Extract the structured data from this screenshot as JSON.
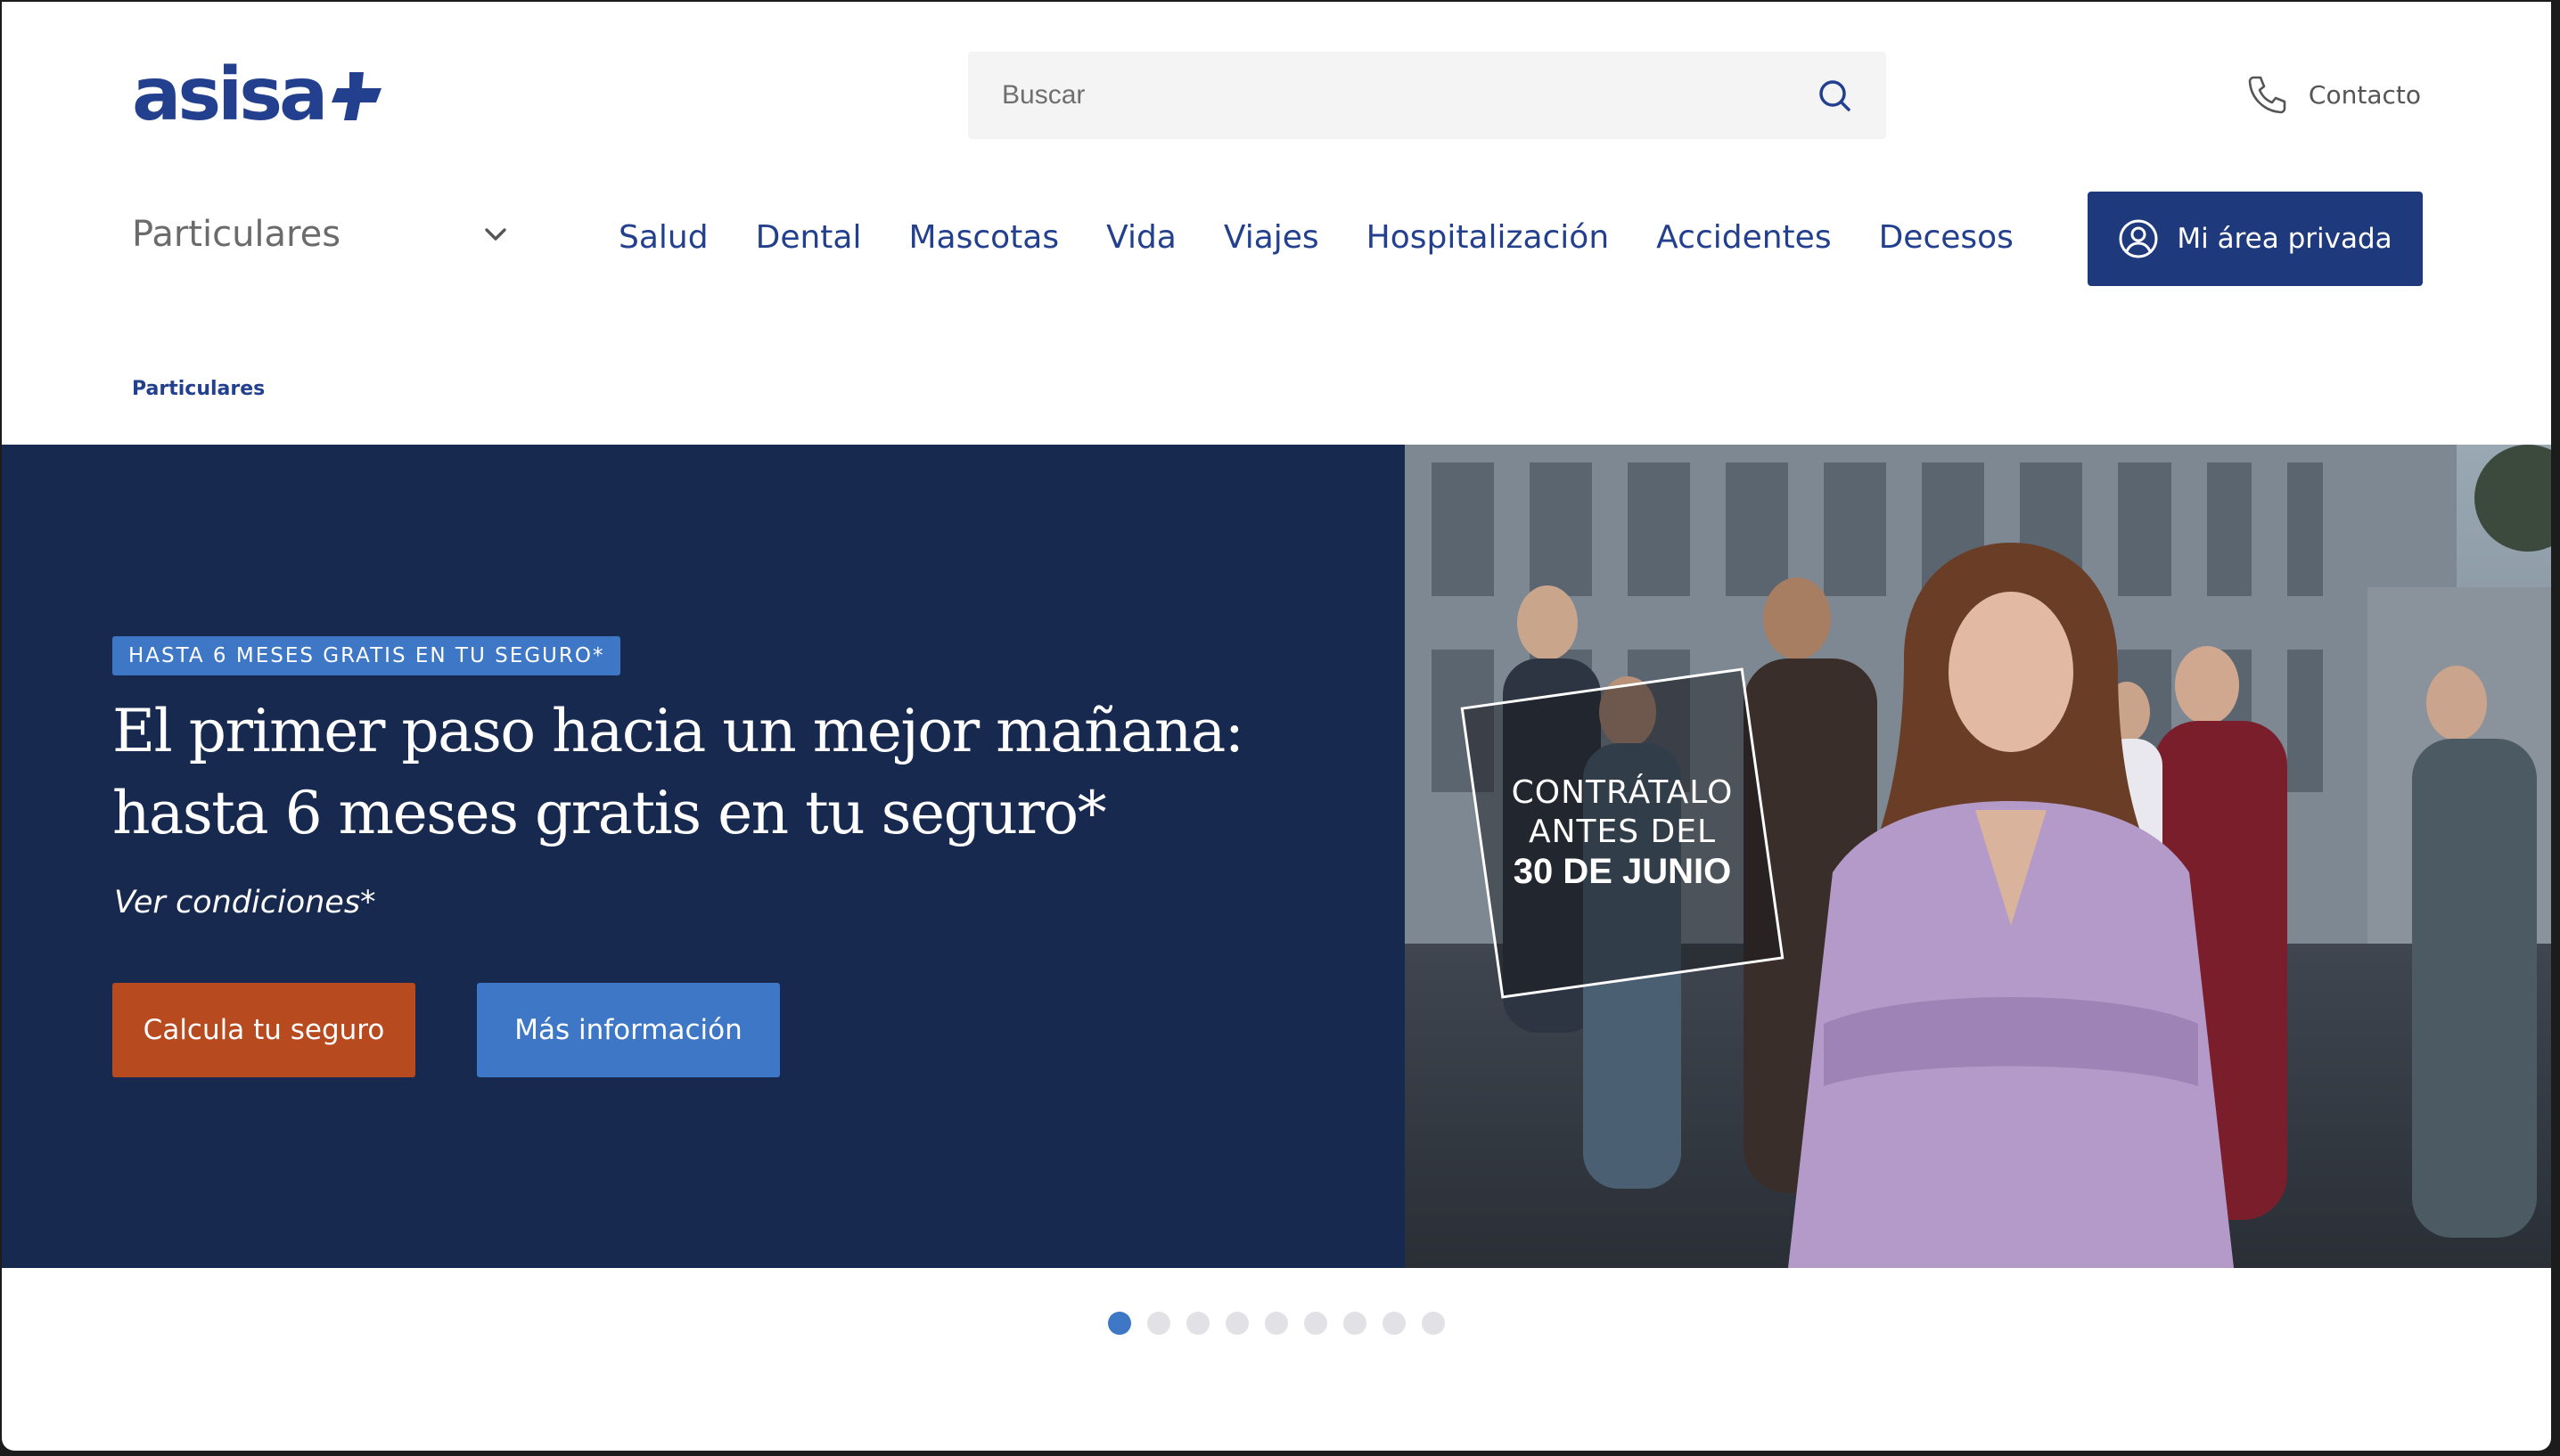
{
  "header": {
    "logo_text": "asisa",
    "search": {
      "placeholder": "Buscar",
      "value": ""
    },
    "contact_label": "Contacto"
  },
  "nav": {
    "segment_label": "Particulares",
    "items": [
      {
        "label": "Salud"
      },
      {
        "label": "Dental"
      },
      {
        "label": "Mascotas"
      },
      {
        "label": "Vida"
      },
      {
        "label": "Viajes"
      },
      {
        "label": "Hospitalización"
      },
      {
        "label": "Accidentes"
      },
      {
        "label": "Decesos"
      }
    ],
    "private_area_label": "Mi área privada"
  },
  "breadcrumb": {
    "current": "Particulares"
  },
  "hero": {
    "badge": "HASTA 6 MESES GRATIS EN TU SEGURO*",
    "title": "El primer paso hacia un mejor mañana: hasta 6 meses gratis en tu seguro*",
    "conditions_link": "Ver condiciones*",
    "primary_button": "Calcula tu seguro",
    "secondary_button": "Más información",
    "stamp": {
      "line1": "CONTRÁTALO",
      "line2": "ANTES DEL",
      "line3": "30 DE JUNIO"
    }
  },
  "carousel": {
    "total_slides": 9,
    "active_slide": 1
  },
  "colors": {
    "brand": "#23408e",
    "hero_bg": "#17294f",
    "accent_orange": "#b84a1f",
    "accent_blue": "#3d77c6"
  },
  "icons": {
    "search": "search-icon",
    "phone": "phone-icon",
    "chevron": "chevron-down-icon",
    "user": "user-circle-icon"
  }
}
